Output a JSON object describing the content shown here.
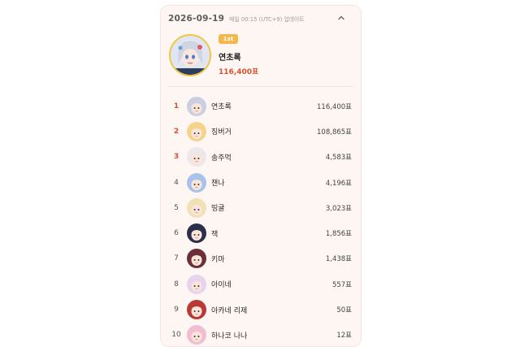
{
  "header": {
    "date": "2026-09-19",
    "update_note": "매일 00:15 (UTC+9) 업데이트"
  },
  "winner": {
    "badge": "1st",
    "name": "연초록",
    "votes": "116,400표"
  },
  "colors": {
    "card_background": "#fdf6f3",
    "accent_red": "#d6512f",
    "badge_gold": "#f2b84b"
  },
  "ranking": [
    {
      "rank": "1",
      "name": "연초록",
      "votes": "116,400표",
      "avatar": "silver-hair-girl",
      "avatar_color": "#c9cfe0"
    },
    {
      "rank": "2",
      "name": "징버거",
      "votes": "108,865표",
      "avatar": "blonde-girl",
      "avatar_color": "#f4d48a"
    },
    {
      "rank": "3",
      "name": "송주먹",
      "votes": "4,583표",
      "avatar": "white-hair-girl",
      "avatar_color": "#ece7ea"
    },
    {
      "rank": "4",
      "name": "챈나",
      "votes": "4,196표",
      "avatar": "blue-hair-girl",
      "avatar_color": "#a9c2ea"
    },
    {
      "rank": "5",
      "name": "띵귤",
      "votes": "3,023표",
      "avatar": "cream-hair-girl",
      "avatar_color": "#f0e2b6"
    },
    {
      "rank": "6",
      "name": "잭",
      "votes": "1,856표",
      "avatar": "dark-hair-character",
      "avatar_color": "#2a2f4a"
    },
    {
      "rank": "7",
      "name": "키마",
      "votes": "1,438표",
      "avatar": "dark-red-hair-girl",
      "avatar_color": "#6b2f3a"
    },
    {
      "rank": "8",
      "name": "아이네",
      "votes": "557표",
      "avatar": "lilac-hair-girl",
      "avatar_color": "#e6d3ee"
    },
    {
      "rank": "9",
      "name": "아카네 리제",
      "votes": "50표",
      "avatar": "red-hair-girl",
      "avatar_color": "#b83a35"
    },
    {
      "rank": "10",
      "name": "하나코 나나",
      "votes": "12표",
      "avatar": "pink-hair-girl",
      "avatar_color": "#f2bcd3"
    }
  ]
}
